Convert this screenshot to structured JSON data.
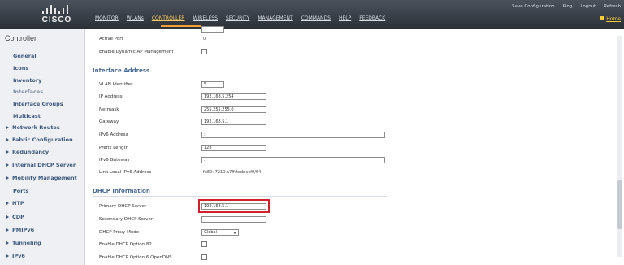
{
  "header": {
    "brand": "CISCO",
    "nav": [
      {
        "label": "MONITOR",
        "active": false
      },
      {
        "label": "WLANs",
        "active": false
      },
      {
        "label": "CONTROLLER",
        "active": true
      },
      {
        "label": "WIRELESS",
        "active": false
      },
      {
        "label": "SECURITY",
        "active": false
      },
      {
        "label": "MANAGEMENT",
        "active": false
      },
      {
        "label": "COMMANDS",
        "active": false
      },
      {
        "label": "HELP",
        "active": false
      },
      {
        "label": "FEEDBACK",
        "active": false
      }
    ],
    "links": {
      "save": "Save Configuration",
      "ping": "Ping",
      "logout": "Logout",
      "refresh": "Refresh",
      "home": "Home"
    }
  },
  "sidebar": {
    "title": "Controller",
    "items": [
      {
        "label": "General",
        "expandable": false,
        "current": false
      },
      {
        "label": "Icons",
        "expandable": false,
        "current": false
      },
      {
        "label": "Inventory",
        "expandable": false,
        "current": false
      },
      {
        "label": "Interfaces",
        "expandable": false,
        "current": true
      },
      {
        "label": "Interface Groups",
        "expandable": false,
        "current": false
      },
      {
        "label": "Multicast",
        "expandable": false,
        "current": false
      },
      {
        "label": "Network Routes",
        "expandable": true,
        "current": false
      },
      {
        "label": "Fabric Configuration",
        "expandable": true,
        "current": false
      },
      {
        "label": "Redundancy",
        "expandable": true,
        "current": false
      },
      {
        "label": "Internal DHCP Server",
        "expandable": true,
        "current": false
      },
      {
        "label": "Mobility Management",
        "expandable": true,
        "current": false
      },
      {
        "label": "Ports",
        "expandable": false,
        "current": false
      },
      {
        "label": "NTP",
        "expandable": true,
        "current": false
      },
      {
        "label": "CDP",
        "expandable": true,
        "current": false
      },
      {
        "label": "PMIPv6",
        "expandable": true,
        "current": false
      },
      {
        "label": "Tunneling",
        "expandable": true,
        "current": false
      },
      {
        "label": "IPv6",
        "expandable": true,
        "current": false
      }
    ]
  },
  "main": {
    "top_rows": {
      "active_port_label": "Active Port",
      "active_port_value": "0",
      "dyn_ap_label": "Enable Dynamic AP Management"
    },
    "interface_address": {
      "heading": "Interface Address",
      "vlan_label": "VLAN Identifier",
      "vlan_value": "5",
      "ip_label": "IP Address",
      "ip_value": "192.168.5.254",
      "netmask_label": "Netmask",
      "netmask_value": "255.255.255.0",
      "gateway_label": "Gateway",
      "gateway_value": "192.168.5.1",
      "ipv6_label": "IPv6 Address",
      "ipv6_value": "::",
      "prefix_label": "Prefix Length",
      "prefix_value": "128",
      "ipv6_gw_label": "IPv6 Gateway",
      "ipv6_gw_value": "::",
      "link_local_label": "Link Local IPv6 Address",
      "link_local_value": "fe80::7210:a7ff:fecb:ccf0/64"
    },
    "dhcp": {
      "heading": "DHCP Information",
      "primary_label": "Primary DHCP Server",
      "primary_value": "192.168.5.1",
      "secondary_label": "Secondary DHCP Server",
      "secondary_value": "",
      "proxy_label": "DHCP Proxy Mode",
      "proxy_value": "Global",
      "opt82_label": "Enable DHCP Option 82",
      "opt6_label": "Enable DHCP Option 6 OpenDNS"
    }
  },
  "colors": {
    "header_bg": "#2b3037",
    "active_nav": "#ffcc66",
    "highlight": "#d1222c",
    "section_heading": "#4a6b94",
    "sidebar_link": "#3e5a7e"
  }
}
